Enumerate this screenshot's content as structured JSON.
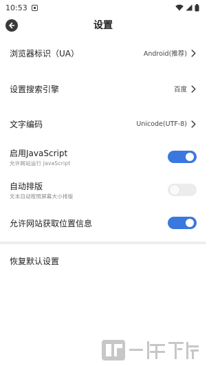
{
  "status_bar": {
    "time": "10:53"
  },
  "header": {
    "title": "设置"
  },
  "settings": {
    "ua": {
      "label": "浏览器标识（UA）",
      "value": "Android(推荐)"
    },
    "search_engine": {
      "label": "设置搜索引擎",
      "value": "百度"
    },
    "encoding": {
      "label": "文字编码",
      "value": "Unicode(UTF-8)"
    },
    "javascript": {
      "label": "启用JavaScript",
      "sub": "允许网站运行 JavaScript",
      "enabled": true
    },
    "auto_layout": {
      "label": "自动排版",
      "sub": "文本自动按照屏幕大小排版",
      "enabled": false
    },
    "location": {
      "label": "允许网站获取位置信息",
      "enabled": true
    }
  },
  "reset": {
    "label": "恢复默认设置"
  },
  "watermark": {
    "text": "一听下载"
  },
  "colors": {
    "toggle_on": "#3a78e0",
    "toggle_off": "#ececec",
    "divider": "#eeeeee"
  },
  "icons": [
    "back-arrow-icon",
    "wifi-icon",
    "signal-icon",
    "battery-icon",
    "chevron-right-icon",
    "notification-icon"
  ]
}
